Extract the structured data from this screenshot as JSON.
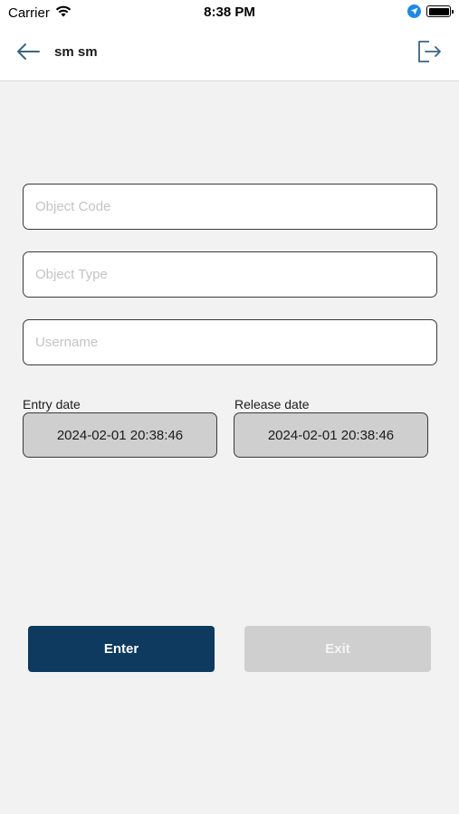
{
  "status_bar": {
    "carrier": "Carrier",
    "time": "8:38 PM",
    "icons": [
      "wifi-icon",
      "location-arrow-icon",
      "battery-icon"
    ]
  },
  "header": {
    "title": "sm sm",
    "back_icon": "arrow-left-icon",
    "logout_icon": "logout-icon"
  },
  "form": {
    "object_code": {
      "placeholder": "Object Code",
      "value": ""
    },
    "object_type": {
      "placeholder": "Object Type",
      "value": ""
    },
    "username": {
      "placeholder": "Username",
      "value": ""
    },
    "entry_date": {
      "label": "Entry date",
      "value": "2024-02-01 20:38:46"
    },
    "release_date": {
      "label": "Release date",
      "value": "2024-02-01 20:38:46"
    }
  },
  "actions": {
    "enter_label": "Enter",
    "exit_label": "Exit"
  },
  "colors": {
    "primary": "#0d3a5e",
    "disabled": "#cfcfcf",
    "background": "#f2f2f2",
    "location_blue": "#1e88e5"
  }
}
